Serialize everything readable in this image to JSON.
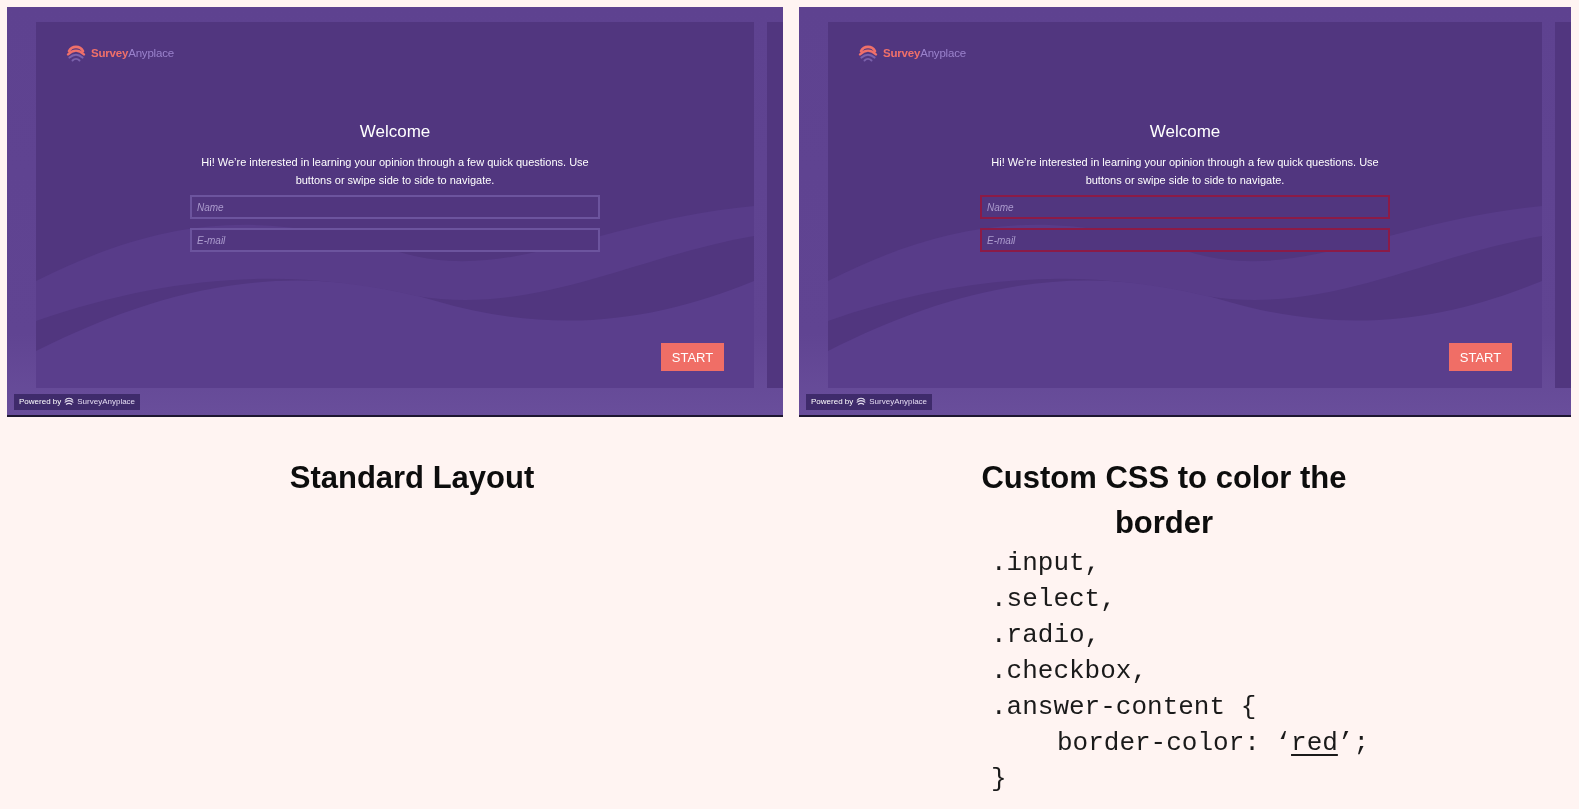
{
  "panels": [
    {
      "screenshot": {
        "logo": {
          "brand": "Survey",
          "suffix": "Anyplace"
        },
        "title": "Welcome",
        "intro": "Hi! We’re interested in learning your opinion through a few quick questions. Use buttons or swipe side to side to navigate.",
        "custom_border": false,
        "fields": [
          {
            "placeholder": "Name"
          },
          {
            "placeholder": "E-mail"
          }
        ],
        "button": "START",
        "powered_by": {
          "label": "Powered by",
          "brand": "SurveyAnyplace"
        }
      },
      "caption": "Standard Layout"
    },
    {
      "screenshot": {
        "logo": {
          "brand": "Survey",
          "suffix": "Anyplace"
        },
        "title": "Welcome",
        "intro": "Hi! We’re interested in learning your opinion through a few quick questions. Use buttons or swipe side to side to navigate.",
        "custom_border": true,
        "fields": [
          {
            "placeholder": "Name"
          },
          {
            "placeholder": "E-mail"
          }
        ],
        "button": "START",
        "powered_by": {
          "label": "Powered by",
          "brand": "SurveyAnyplace"
        }
      },
      "caption": "Custom CSS to color the border",
      "code": [
        {
          "indented": false,
          "segments": [
            {
              "text": ".input,",
              "underlined": false
            }
          ]
        },
        {
          "indented": false,
          "segments": [
            {
              "text": ".select,",
              "underlined": false
            }
          ]
        },
        {
          "indented": false,
          "segments": [
            {
              "text": ".radio,",
              "underlined": false
            }
          ]
        },
        {
          "indented": false,
          "segments": [
            {
              "text": ".checkbox,",
              "underlined": false
            }
          ]
        },
        {
          "indented": false,
          "segments": [
            {
              "text": ".answer-content {",
              "underlined": false
            }
          ]
        },
        {
          "indented": true,
          "segments": [
            {
              "text": "border-color: ‘",
              "underlined": false
            },
            {
              "text": "red",
              "underlined": true
            },
            {
              "text": "’;",
              "underlined": false
            }
          ]
        },
        {
          "indented": false,
          "segments": [
            {
              "text": "}",
              "underlined": false
            }
          ]
        }
      ]
    }
  ]
}
